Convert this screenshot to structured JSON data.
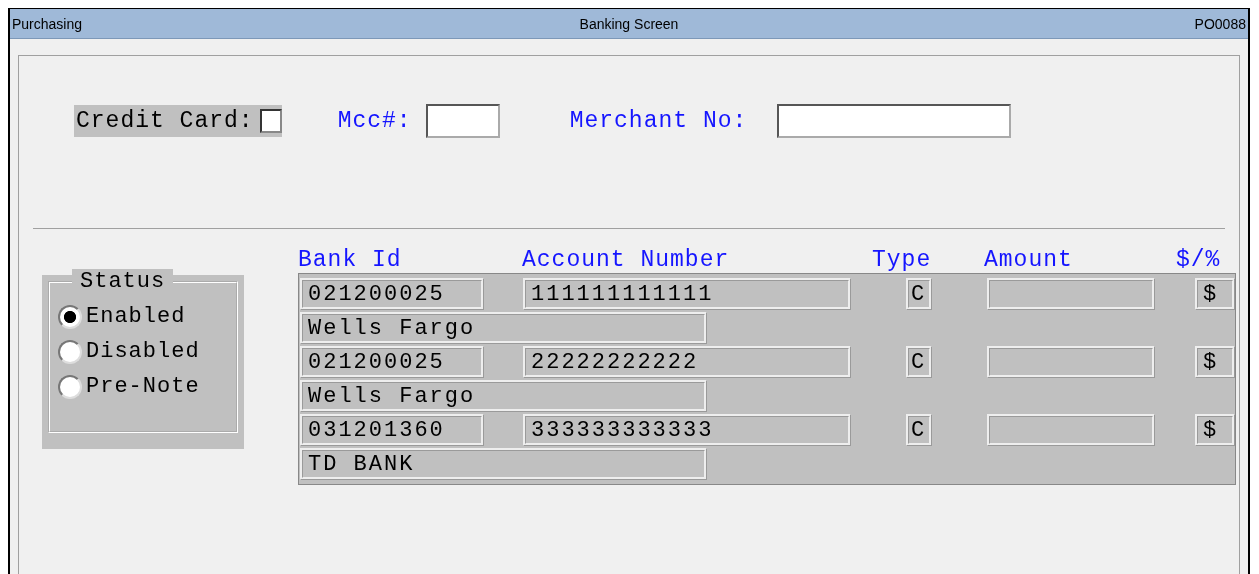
{
  "window": {
    "module": "Purchasing",
    "title": "Banking Screen",
    "code": "PO0088"
  },
  "credit_card": {
    "label": "Credit Card:",
    "checked": false
  },
  "mcc": {
    "label": "Mcc#:"
  },
  "merchant": {
    "label": "Merchant No:"
  },
  "status": {
    "title": "Status",
    "options": [
      {
        "label": "Enabled",
        "selected": true
      },
      {
        "label": "Disabled",
        "selected": false
      },
      {
        "label": "Pre-Note",
        "selected": false
      }
    ]
  },
  "table": {
    "columns": [
      "Bank Id",
      "Account Number",
      "Type",
      "Amount",
      "$/%"
    ],
    "rows": [
      {
        "bank_id": "021200025",
        "account_number": "111111111111",
        "type": "C",
        "unit": "$",
        "bank_name": "Wells Fargo"
      },
      {
        "bank_id": "021200025",
        "account_number": "22222222222",
        "type": "C",
        "unit": "$",
        "bank_name": "Wells Fargo"
      },
      {
        "bank_id": "031201360",
        "account_number": "333333333333",
        "type": "C",
        "unit": "$",
        "bank_name": "TD BANK"
      }
    ]
  }
}
